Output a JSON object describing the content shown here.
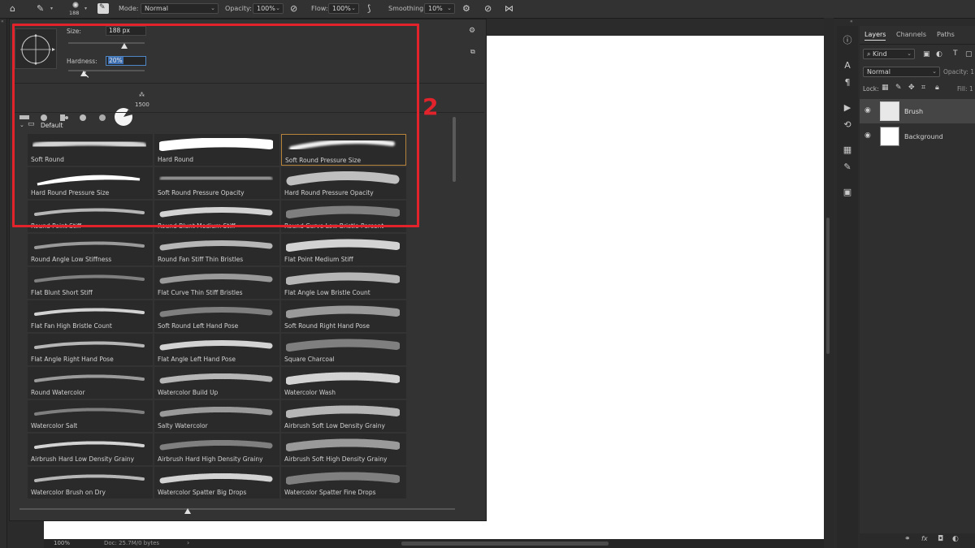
{
  "options_bar": {
    "brush_size": "188",
    "mode_label": "Mode:",
    "mode_value": "Normal",
    "opacity_label": "Opacity:",
    "opacity_value": "100%",
    "flow_label": "Flow:",
    "flow_value": "100%",
    "smoothing_label": "Smoothing:",
    "smoothing_value": "10%"
  },
  "brush_panel": {
    "size_label": "Size:",
    "size_value": "188 px",
    "hardness_label": "Hardness:",
    "hardness_value": "20%",
    "tip_size_label": "1500",
    "group_label": "Default",
    "brushes": [
      "Soft Round",
      "Hard Round",
      "Soft Round Pressure Size",
      "Hard Round Pressure Size",
      "Soft Round Pressure Opacity",
      "Hard Round Pressure Opacity",
      "Round Point Stiff",
      "Round Blunt Medium Stiff",
      "Round Curve Low Bristle Percent",
      "Round Angle Low Stiffness",
      "Round Fan Stiff Thin Bristles",
      "Flat Point Medium Stiff",
      "Flat Blunt Short Stiff",
      "Flat Curve Thin Stiff Bristles",
      "Flat Angle Low Bristle Count",
      "Flat Fan High Bristle Count",
      "Soft Round Left Hand Pose",
      "Soft Round Right Hand Pose",
      "Flat Angle Right Hand Pose",
      "Flat Angle Left Hand Pose",
      "Square Charcoal",
      "Round Watercolor",
      "Watercolor Build Up",
      "Watercolor Wash",
      "Watercolor Salt",
      "Salty Watercolor",
      "Airbrush Soft Low Density Grainy",
      "Airbrush Hard Low Density Grainy",
      "Airbrush Hard High Density Grainy",
      "Airbrush Soft High Density Grainy",
      "Watercolor Brush on Dry",
      "Watercolor Spatter Big Drops",
      "Watercolor Spatter Fine Drops"
    ],
    "selected_index": 2,
    "callout_number": "2"
  },
  "layers_panel": {
    "tabs": [
      "Layers",
      "Channels",
      "Paths"
    ],
    "kind_label": "Kind",
    "blend_mode": "Normal",
    "opacity_label": "Opacity:",
    "opacity_value": "1",
    "lock_label": "Lock:",
    "fill_label": "Fill:",
    "fill_value": "1",
    "layers": [
      "Brush",
      "Background"
    ]
  },
  "status_bar": {
    "zoom": "100%",
    "doc_info": "Doc: 25.7M/0 bytes"
  },
  "colors": {
    "accent_red": "#e3232b",
    "selection_border": "#b5843a",
    "canvas": "#ffffff"
  }
}
